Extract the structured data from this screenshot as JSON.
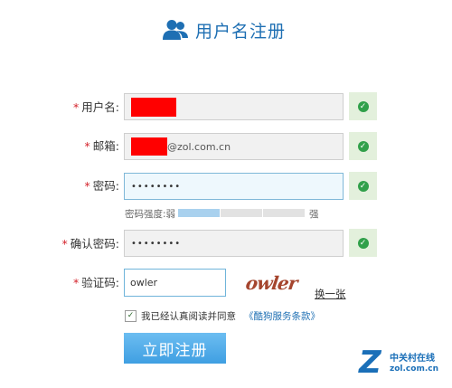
{
  "header": {
    "title": "用户名注册",
    "icon": "users-icon"
  },
  "form": {
    "username": {
      "label": "用户名:",
      "value": "",
      "valid": true
    },
    "email": {
      "label": "邮箱:",
      "value_suffix": "@zol.com.cn",
      "valid": true
    },
    "password": {
      "label": "密码:",
      "value": "••••••••",
      "valid": true
    },
    "strength": {
      "label": "密码强度:弱",
      "strong_label": "强",
      "level": 1,
      "levels": 3
    },
    "confirm": {
      "label": "确认密码:",
      "value": "••••••••",
      "valid": true
    },
    "captcha": {
      "label": "验证码:",
      "value": "owler",
      "image_text": "owler",
      "refresh_label": "换一张"
    },
    "agree": {
      "checked": true,
      "text": "我已经认真阅读并同意",
      "link": "《酷狗服务条款》"
    },
    "submit_label": "立即注册",
    "required_mark": "*"
  },
  "watermark": {
    "cn": "中关村在线",
    "en": "zol.com.cn",
    "logo": "Z"
  },
  "colors": {
    "accent": "#1e6fb3",
    "required": "#d4222a",
    "valid": "#31a04a",
    "redaction": "#ff0000"
  }
}
